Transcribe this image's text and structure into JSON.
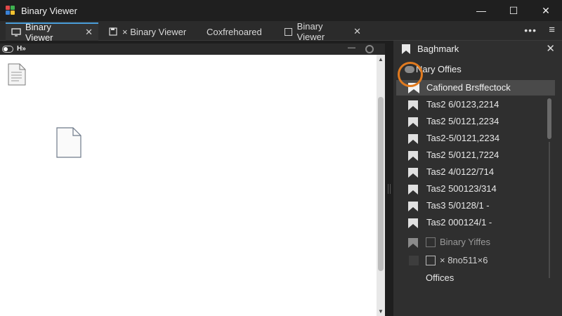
{
  "window": {
    "title": "Binary Viewer",
    "controls": {
      "minimize": "—",
      "maximize": "☐",
      "close": "✕"
    }
  },
  "tabs": [
    {
      "label": "Binary Viewer",
      "icon": "monitor-icon",
      "active": true
    },
    {
      "label": "× Binary Viewer",
      "icon": "save-icon",
      "active": false
    },
    {
      "label": "Coxfrehoared",
      "icon": "",
      "active": false
    },
    {
      "label": "Binary Viewer",
      "icon": "checkbox-icon",
      "active": false
    }
  ],
  "tabbar": {
    "more": "•••",
    "menu": "≡"
  },
  "editor": {
    "toolbar_label": "H»",
    "minimize": "—"
  },
  "panel": {
    "title": "Baghmark",
    "close": "✕",
    "group_label": "Nary Offies",
    "selected_label": "Cafioned Brsffectock",
    "items": [
      "Tas2 6/0123,2214",
      "Tas2 5/0121,2234",
      "Tas2-5/0121,2234",
      "Tas2 5/0121,7224",
      "Tas2 4/0122/714",
      "Tas2 500123/314",
      "Tas3 5/0128/1 -",
      "Tas2 000124/1 -"
    ],
    "checkbox_items": [
      "Binary Yiffes",
      "× 8no511×6"
    ],
    "footer_label": "Offices"
  },
  "colors": {
    "accent": "#4a9eda",
    "focus_ring": "#e07a1f",
    "panel_bg": "#2f2f2f",
    "editor_bg": "#ffffff"
  }
}
